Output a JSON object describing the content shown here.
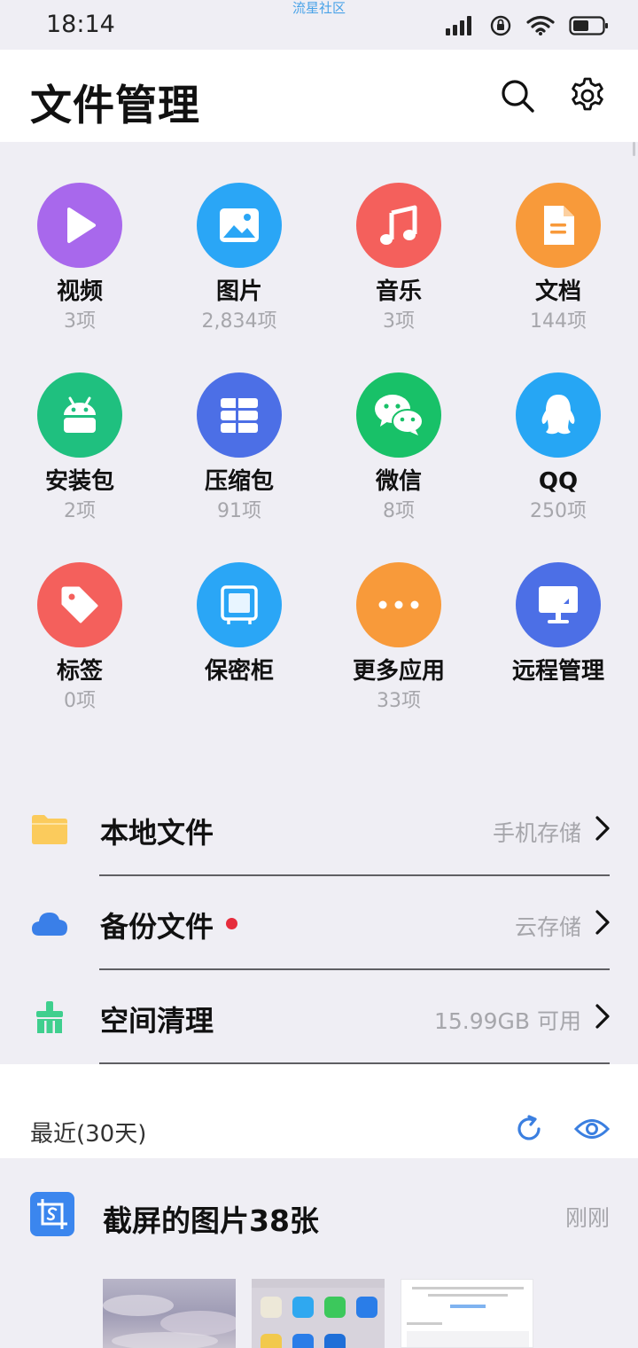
{
  "status_bar": {
    "time": "18:14",
    "watermark": "流星社区",
    "icons": [
      "cellular-signal-icon",
      "orientation-lock-icon",
      "wifi-icon",
      "battery-icon"
    ]
  },
  "header": {
    "title": "文件管理",
    "search_icon": "search-icon",
    "settings_icon": "gear-icon"
  },
  "categories": [
    {
      "label": "视频",
      "count": "3项",
      "icon": "play-icon",
      "color": "#a868ec"
    },
    {
      "label": "图片",
      "count": "2,834项",
      "icon": "image-icon",
      "color": "#2aa6f6"
    },
    {
      "label": "音乐",
      "count": "3项",
      "icon": "music-note-icon",
      "color": "#f4605c"
    },
    {
      "label": "文档",
      "count": "144项",
      "icon": "document-icon",
      "color": "#f89a3a"
    },
    {
      "label": "安装包",
      "count": "2项",
      "icon": "android-icon",
      "color": "#1fc07f"
    },
    {
      "label": "压缩包",
      "count": "91项",
      "icon": "archive-icon",
      "color": "#4c6fe6"
    },
    {
      "label": "微信",
      "count": "8项",
      "icon": "wechat-icon",
      "color": "#18c168"
    },
    {
      "label": "QQ",
      "count": "250项",
      "icon": "qq-penguin-icon",
      "color": "#26a6f4"
    },
    {
      "label": "标签",
      "count": "0项",
      "icon": "tag-icon",
      "color": "#f4605c"
    },
    {
      "label": "保密柜",
      "count": "",
      "icon": "safe-icon",
      "color": "#2aa6f6"
    },
    {
      "label": "更多应用",
      "count": "33项",
      "icon": "more-dots-icon",
      "color": "#f89a3a"
    },
    {
      "label": "远程管理",
      "count": "",
      "icon": "monitor-icon",
      "color": "#4c6fe6"
    }
  ],
  "entries": [
    {
      "title": "本地文件",
      "meta": "手机存储",
      "icon": "folder-icon",
      "color": "#fbcb5c",
      "dot": false
    },
    {
      "title": "备份文件",
      "meta": "云存储",
      "icon": "cloud-icon",
      "color": "#3a7fe8",
      "dot": true
    },
    {
      "title": "空间清理",
      "meta": "15.99GB 可用",
      "icon": "broom-icon",
      "color": "#3fcf8e",
      "dot": false
    }
  ],
  "recent": {
    "title": "最近(30天)",
    "refresh_icon": "refresh-icon",
    "visibility_icon": "eye-icon",
    "accent": "#3b7fe0"
  },
  "recent_group": {
    "title": "截屏的图片38张",
    "time": "刚刚",
    "icon": "screenshot-crop-icon"
  }
}
